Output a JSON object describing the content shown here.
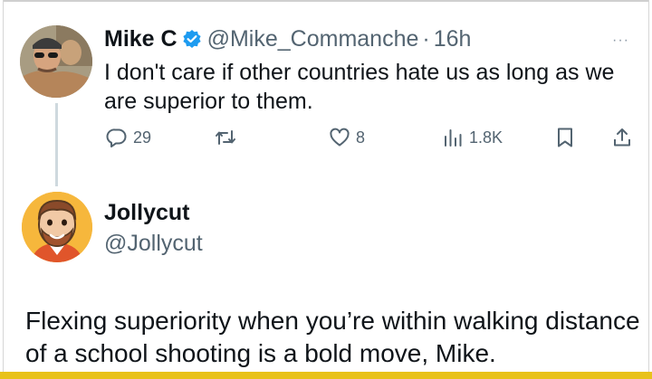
{
  "tweet": {
    "author_name": "Mike C",
    "author_handle": "@Mike_Commanche",
    "separator": "·",
    "time": "16h",
    "more_label": "···",
    "text": "I don't care if other countries hate us as long as we are superior to them.",
    "actions": {
      "replies": "29",
      "likes": "8",
      "views": "1.8K"
    },
    "icons": [
      "reply-icon",
      "retweet-icon",
      "like-icon",
      "views-icon",
      "bookmark-icon",
      "share-icon"
    ],
    "verified_color": "#1d9bf0"
  },
  "reply": {
    "author_name": "Jollycut",
    "author_handle": "@Jollycut",
    "text": "Flexing superiority when you’re within walking distance of a school shooting is a bold move, Mike."
  },
  "colors": {
    "text": "#0f1419",
    "secondary": "#536471",
    "thread_line": "#cfd9de",
    "bottom_strip": "#e8c21a"
  }
}
